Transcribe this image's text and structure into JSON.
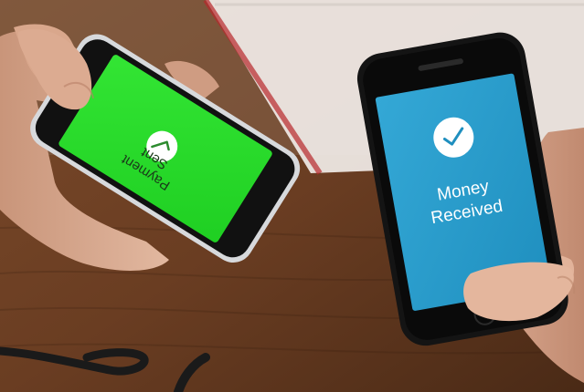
{
  "scene": {
    "left_phone": {
      "line1": "Payment",
      "line2": "Sent",
      "screen_color": "#25e02a",
      "icon": "check-circle-icon"
    },
    "right_phone": {
      "line1": "Money",
      "line2": "Received",
      "screen_color": "#2aa0cf",
      "icon": "check-circle-icon"
    }
  }
}
